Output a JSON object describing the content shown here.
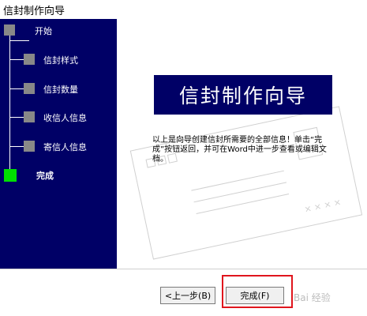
{
  "window": {
    "title": "信封制作向导"
  },
  "steps": [
    {
      "label": "开始",
      "state": "done"
    },
    {
      "label": "信封样式",
      "state": "done"
    },
    {
      "label": "信封数量",
      "state": "done"
    },
    {
      "label": "收信人信息",
      "state": "done"
    },
    {
      "label": "寄信人信息",
      "state": "done"
    },
    {
      "label": "完成",
      "state": "current"
    }
  ],
  "main": {
    "banner": "信封制作向导",
    "message": "以上是向导创建信封所需要的全部信息！单击“完成”按钮返回，并可在Word中进一步查看或编辑文档。"
  },
  "buttons": {
    "back": "<上一步(B)",
    "finish": "完成(F)"
  },
  "watermark": "Bai 经验",
  "colors": {
    "sidebar": "#000066",
    "current_step": "#00e000",
    "step_box": "#888888",
    "highlight": "#e0151d"
  }
}
